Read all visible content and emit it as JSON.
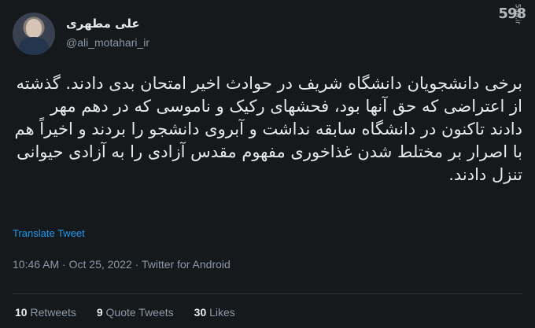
{
  "profile": {
    "name": "علی مطهری",
    "handle": "@ali_motahari_ir"
  },
  "watermark": {
    "brand": "598",
    "url": "598.ir"
  },
  "tweet": {
    "text": "برخی دانشجویان دانشگاه شریف در حوادث اخیر امتحان بدی دادند. گذشته از اعتراضی که حق آنها بود، فحشهای رکیک و ناموسی که در دهم مهر دادند تاکنون در دانشگاه سابقه نداشت و آبروی دانشجو را بردند و اخیراً هم با اصرار بر مختلط شدن غذاخوری مفهوم مقدس آزادی را به آزادی حیوانی تنزل دادند."
  },
  "actions": {
    "translate": "Translate Tweet"
  },
  "meta": {
    "time": "10:46 AM",
    "date": "Oct 25, 2022",
    "source": "Twitter for Android"
  },
  "stats": {
    "retweets": {
      "count": "10",
      "label": "Retweets"
    },
    "quotes": {
      "count": "9",
      "label": "Quote Tweets"
    },
    "likes": {
      "count": "30",
      "label": "Likes"
    }
  },
  "colors": {
    "background": "#15191c",
    "text": "#e7e9ea",
    "secondary": "#8b98a5",
    "link": "#1d9bf0"
  }
}
